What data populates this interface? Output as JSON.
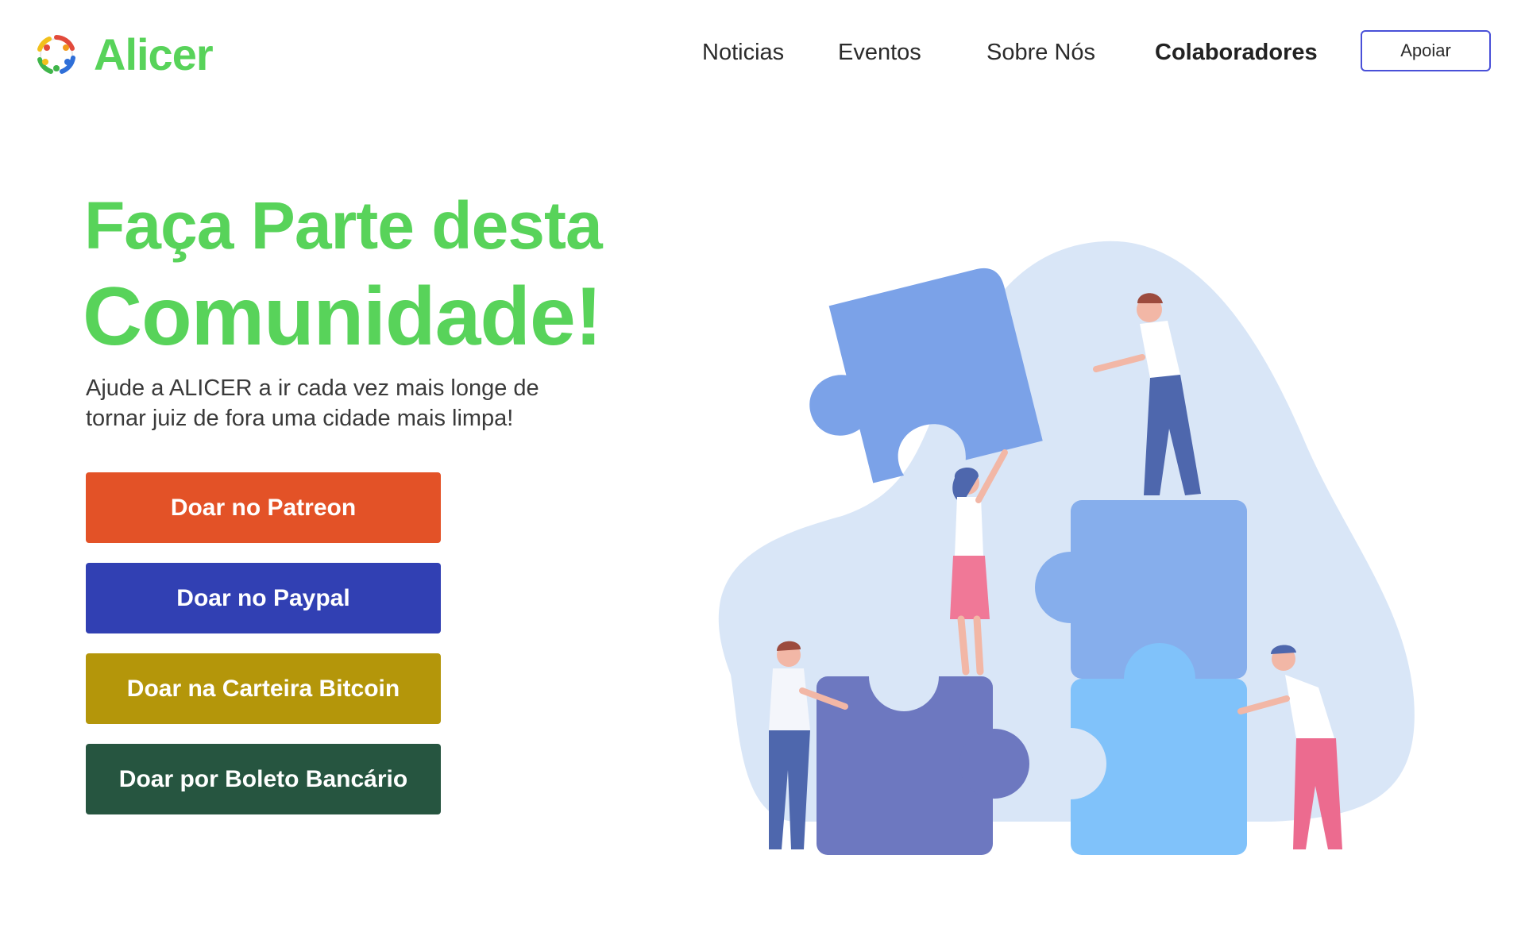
{
  "brand": {
    "name": "Alicer",
    "color": "#58d35a"
  },
  "nav": {
    "items": [
      {
        "label": "Noticias",
        "active": false
      },
      {
        "label": "Eventos",
        "active": false
      },
      {
        "label": "Sobre Nós",
        "active": false
      },
      {
        "label": "Colaboradores",
        "active": true
      }
    ],
    "cta_label": "Apoiar"
  },
  "hero": {
    "title_line1": "Faça Parte desta",
    "title_line2": "Comunidade!",
    "subtitle_line1": "Ajude a ALICER a ir cada vez mais longe de",
    "subtitle_line2": "tornar juiz de fora uma cidade mais limpa!"
  },
  "donate_buttons": [
    {
      "label": "Doar no Patreon",
      "color": "#e35227"
    },
    {
      "label": "Doar no Paypal",
      "color": "#3140b3"
    },
    {
      "label": "Doar na Carteira Bitcoin",
      "color": "#b4960a"
    },
    {
      "label": "Doar por Boleto Bancário",
      "color": "#265540"
    }
  ],
  "illustration": {
    "subject": "people assembling puzzle pieces"
  }
}
